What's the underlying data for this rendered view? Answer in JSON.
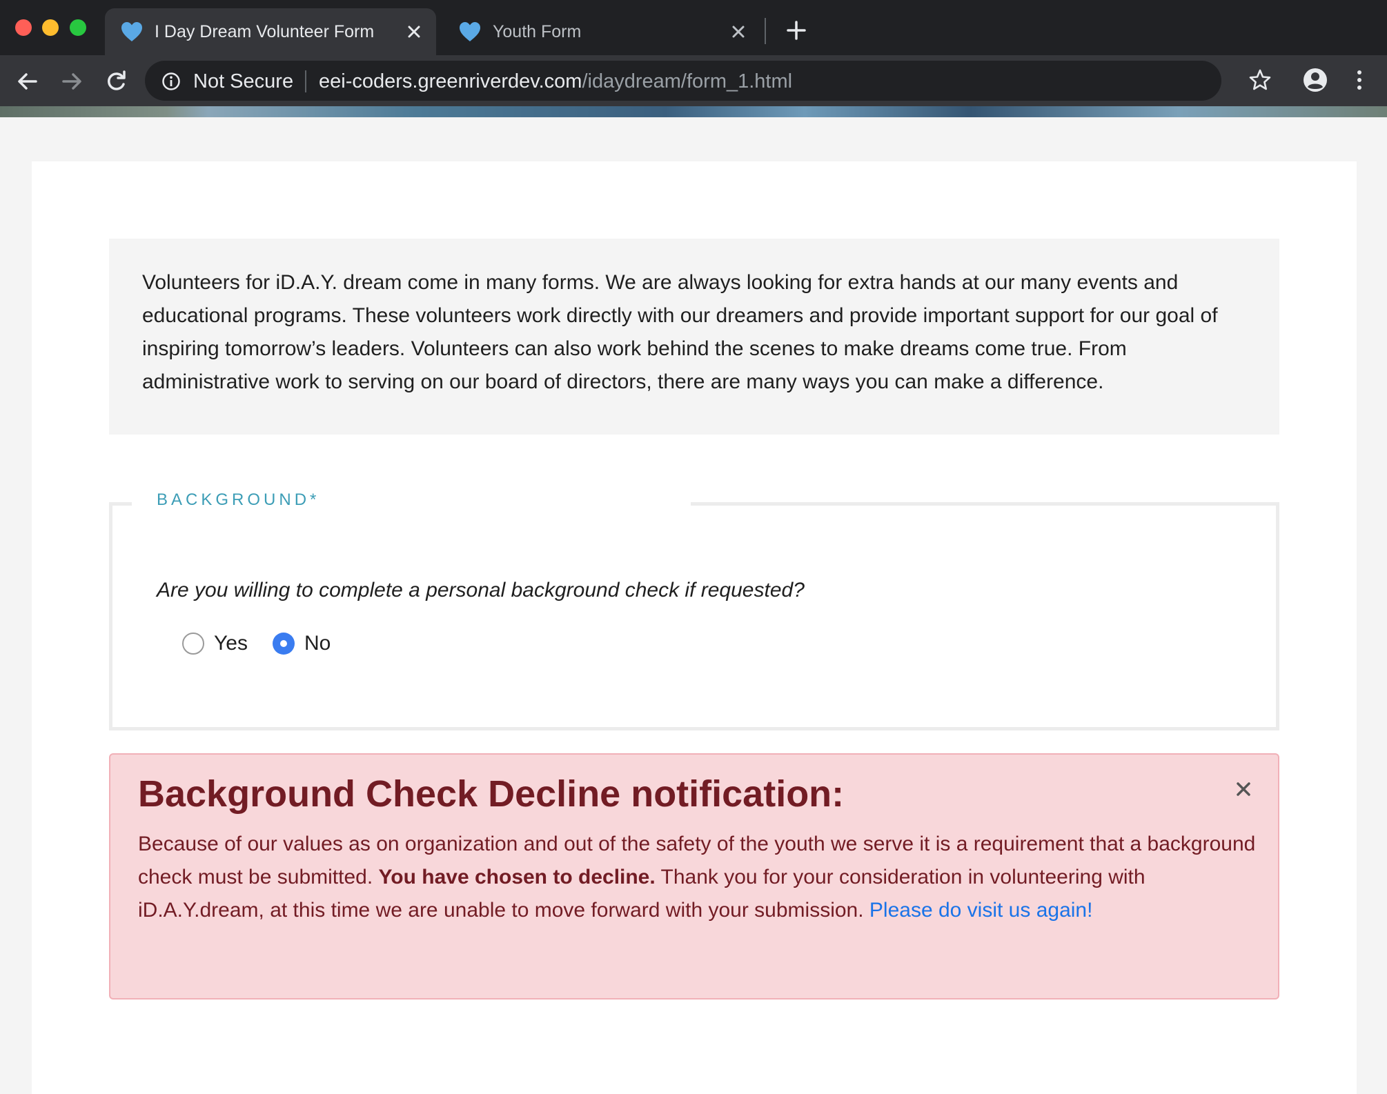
{
  "browser": {
    "tabs": [
      {
        "title": "I Day Dream Volunteer Form",
        "active": true,
        "icon": "heart-icon"
      },
      {
        "title": "Youth Form",
        "active": false,
        "icon": "heart-icon"
      }
    ],
    "security_label": "Not Secure",
    "url_host": "eei-coders.greenriverdev.com",
    "url_path": "/idaydream/form_1.html"
  },
  "intro": {
    "text": "Volunteers for iD.A.Y. dream come in many forms. We are always looking for extra hands at our many events and educational programs. These volunteers work directly with our dreamers and provide important support for our goal of inspiring tomorrow’s leaders. Volunteers can also work behind the scenes to make dreams come true. From administrative work to serving on our board of directors, there are many ways you can make a difference."
  },
  "background_section": {
    "legend": "BACKGROUND*",
    "question": "Are you willing to complete a personal background check if requested?",
    "options": [
      {
        "label": "Yes",
        "checked": false
      },
      {
        "label": "No",
        "checked": true
      }
    ]
  },
  "alert": {
    "title": "Background Check Decline notification:",
    "body_part1": "Because of our values as on organization and out of the safety of the youth we serve it is a requirement that a background check must be submitted. ",
    "body_bold": "You have chosen to decline.",
    "body_part2": " Thank you for your consideration in volunteering with iD.A.Y.dream, at this time we are unable to move forward with your submission. ",
    "link_text": "Please do visit us again!"
  },
  "colors": {
    "accent": "#3c9db6",
    "alert_bg": "#f8d7da",
    "alert_text": "#721c24",
    "link": "#1a73e8",
    "radio_checked": "#3a7cf0"
  }
}
